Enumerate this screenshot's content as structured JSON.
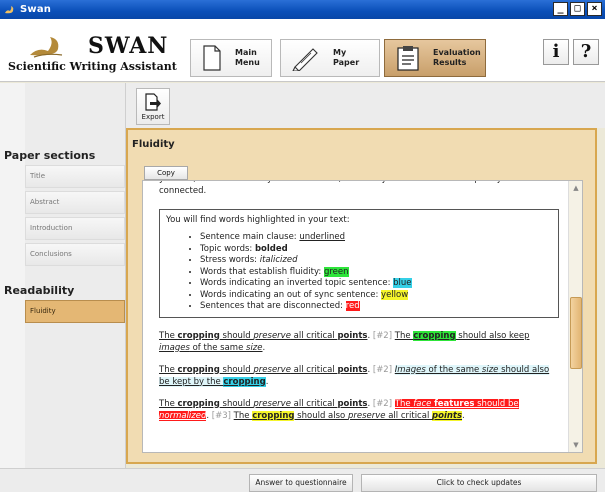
{
  "window": {
    "title": "Swan",
    "minimize": "_",
    "maximize": "□",
    "close": "×"
  },
  "logo": {
    "title": "SWAN",
    "subtitle": "Scientific Writing Assistant"
  },
  "nav": {
    "main_menu": "Main\nMenu",
    "my_paper": "My\nPaper",
    "evaluation": "Evaluation\nResults"
  },
  "header_buttons": {
    "info": "i",
    "help": "?"
  },
  "toolbar": {
    "export_label": "Export"
  },
  "sidebar": {
    "paper_sections_heading": "Paper sections",
    "sections": [
      "Title",
      "Abstract",
      "Introduction",
      "Conclusions"
    ],
    "readability_heading": "Readability",
    "readability_items": [
      "Fluidity"
    ]
  },
  "panel": {
    "title": "Fluidity",
    "copy_label": "Copy",
    "intro": "yourself, on a sentence-by-sentence basis, whether your sentences are topically well-connected.",
    "legend_title": "You will find words highlighted in your text:",
    "legend": [
      {
        "prefix": "Sentence main clause: ",
        "sample": "underlined"
      },
      {
        "prefix": "Topic words: ",
        "sample": "bolded"
      },
      {
        "prefix": "Stress words: ",
        "sample": "italicized"
      },
      {
        "prefix": "Words that establish fluidity: ",
        "sample": "green"
      },
      {
        "prefix": "Words indicating an inverted topic sentence: ",
        "sample": "blue"
      },
      {
        "prefix": "Words indicating an out of sync sentence: ",
        "sample": "yellow"
      },
      {
        "prefix": "Sentences that are disconnected: ",
        "sample": "red"
      }
    ],
    "ex1": {
      "s1a": "The ",
      "s1b": "cropping",
      "s1c": " should ",
      "s1d": "preserve",
      "s1e": " all critical ",
      "s1f": "points",
      "s1g": ".",
      "ref": " [#2] ",
      "s2a": "The ",
      "s2b": "cropping",
      "s2c": " should also keep ",
      "s2d": "images",
      "s2e": " of the same ",
      "s2f": "size",
      "s2g": "."
    },
    "ex2": {
      "s1a": "The ",
      "s1b": "cropping",
      "s1c": " should ",
      "s1d": "preserve",
      "s1e": " all critical ",
      "s1f": "points",
      "s1g": ".",
      "ref": " [#2] ",
      "s2a": "Images",
      "s2b": " of the same ",
      "s2c": "size",
      "s2d": " should also be kept by the ",
      "s2e": "cropping",
      "s2f": "."
    },
    "ex3": {
      "s1a": "The ",
      "s1b": "cropping",
      "s1c": " should ",
      "s1d": "preserve",
      "s1e": " all critical ",
      "s1f": "points",
      "s1g": ".",
      "ref2": " [#2] ",
      "s2a": "The ",
      "s2b": "face",
      "s2c": " ",
      "s2d": "features",
      "s2e": " should be ",
      "s2f": "normalized",
      "s2g": ".",
      "ref3": " [#3] ",
      "s3a": "The ",
      "s3b": "cropping",
      "s3c": " should also ",
      "s3d": "preserve",
      "s3e": " all critical ",
      "s3f": "points",
      "s3g": "."
    }
  },
  "bottom": {
    "questionnaire": "Answer to questionnaire",
    "updates": "Click to check updates"
  },
  "colors": {
    "accent": "#d8a74f",
    "green": "#2ee53a",
    "blue": "#35d0e7",
    "yellow": "#f5f52b",
    "red": "#ff1a1a"
  }
}
